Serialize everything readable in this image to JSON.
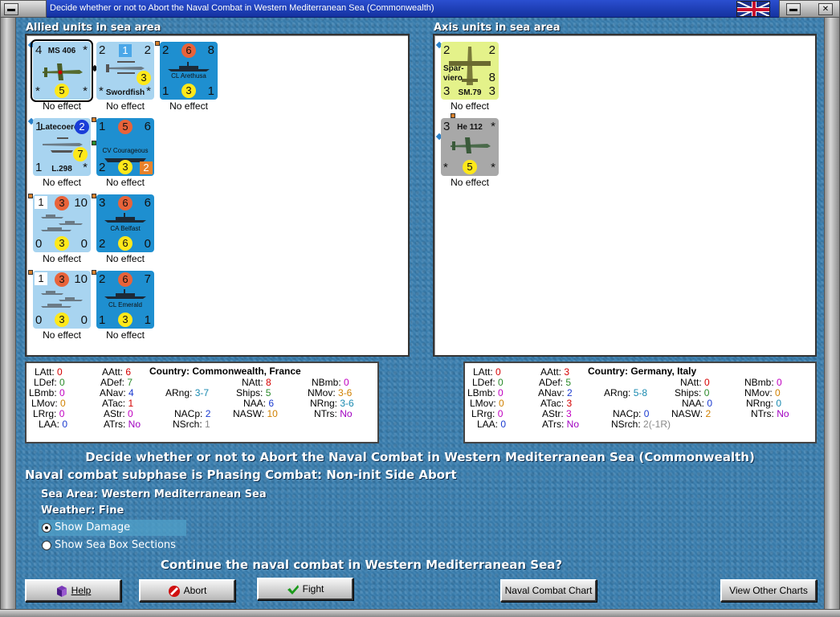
{
  "window": {
    "title": "Decide whether or not to Abort the Naval Combat in Western Mediterranean Sea (Commonwealth)",
    "btn_menu": "▬",
    "btn_close": "✕",
    "btn_min": "▬"
  },
  "allied": {
    "label": "Allied units in sea area",
    "units": [
      {
        "name": "MS 406",
        "tl": "4",
        "tr": "*",
        "bl": "*",
        "br": "*",
        "circle": "5",
        "status": "No effect"
      },
      {
        "name": "Swordfish",
        "tl": "2",
        "mid": "1",
        "tr": "2",
        "bl": "*",
        "br": "*",
        "circle": "3",
        "status": "No effect"
      },
      {
        "name": "CL Arethusa",
        "tl": "2",
        "top": "6",
        "tr": "8",
        "bl": "1",
        "bm": "3",
        "br": "1",
        "status": "No effect"
      },
      {
        "name": "Latecoere",
        "sub": "L.298",
        "tl": "1",
        "tr": "2",
        "bl": "1",
        "br": "*",
        "circle": "7",
        "status": "No effect"
      },
      {
        "name": "CV Courageous",
        "tl": "1",
        "top": "5",
        "tr": "6",
        "bl": "2",
        "bm": "3",
        "br": "2",
        "status": "No effect"
      },
      {
        "name": "Convoy",
        "tl": "1",
        "top": "3",
        "tr": "10",
        "bl": "0",
        "bm": "3",
        "br": "0",
        "status": "No effect"
      },
      {
        "name": "CA Belfast",
        "tl": "3",
        "top": "6",
        "tr": "6",
        "bl": "2",
        "bm": "6",
        "br": "0",
        "status": "No effect"
      },
      {
        "name": "Convoy",
        "tl": "1",
        "top": "3",
        "tr": "10",
        "bl": "0",
        "bm": "3",
        "br": "0",
        "status": "No effect"
      },
      {
        "name": "CL Emerald",
        "tl": "2",
        "top": "6",
        "tr": "7",
        "bl": "1",
        "bm": "3",
        "br": "1",
        "status": "No effect"
      }
    ]
  },
  "axis": {
    "label": "Axis units in sea area",
    "units": [
      {
        "name": "SM.79",
        "side": "Spar-",
        "side2": "viero",
        "tl": "2",
        "tr": "2",
        "bl": "3",
        "br": "3",
        "circle": "8",
        "status": "No effect"
      },
      {
        "name": "He 112",
        "tl": "3",
        "tr": "*",
        "bl": "*",
        "br": "*",
        "circle": "5",
        "status": "No effect"
      }
    ]
  },
  "allied_stats": {
    "country": "Country: Commonwealth, France",
    "LAtt": "0",
    "LDef": "0",
    "LBmb": "0",
    "LMov": "0",
    "LRrg": "0",
    "LAA": "0",
    "AAtt": "6",
    "ADef": "7",
    "ANav": "4",
    "ATac": "1",
    "AStr": "0",
    "ATrs": "No",
    "ARng": "3-7",
    "NAtt": "8",
    "Ships": "5",
    "NAA": "6",
    "NASW": "10",
    "NACp": "2",
    "NSrch": "1",
    "NBmb": "0",
    "NMov": "3-6",
    "NRng": "3-6",
    "NTrs": "No"
  },
  "axis_stats": {
    "country": "Country: Germany, Italy",
    "LAtt": "0",
    "LDef": "0",
    "LBmb": "0",
    "LMov": "0",
    "LRrg": "0",
    "LAA": "0",
    "AAtt": "3",
    "ADef": "5",
    "ANav": "2",
    "ATac": "3",
    "AStr": "3",
    "ATrs": "No",
    "ARng": "5-8",
    "NAtt": "0",
    "Ships": "0",
    "NAA": "0",
    "NASW": "2",
    "NACp": "0",
    "NSrch": "2(-1R)",
    "NBmb": "0",
    "NMov": "0",
    "NRng": "0",
    "NTrs": "No"
  },
  "main": {
    "heading": "Decide whether or not to Abort the Naval Combat in Western Mediterranean Sea (Commonwealth)",
    "subphase": "Naval combat subphase is Phasing Combat: Non-init Side Abort",
    "sea_area": "Sea Area:  Western Mediterranean Sea",
    "weather": "Weather:  Fine",
    "opt_damage": "Show Damage",
    "opt_sections": "Show Sea Box Sections",
    "question": "Continue the naval combat in Western Mediterranean Sea?"
  },
  "buttons": {
    "help": "Help",
    "abort": "Abort",
    "fight": "Fight",
    "chart": "Naval Combat Chart",
    "other": "View Other Charts"
  }
}
